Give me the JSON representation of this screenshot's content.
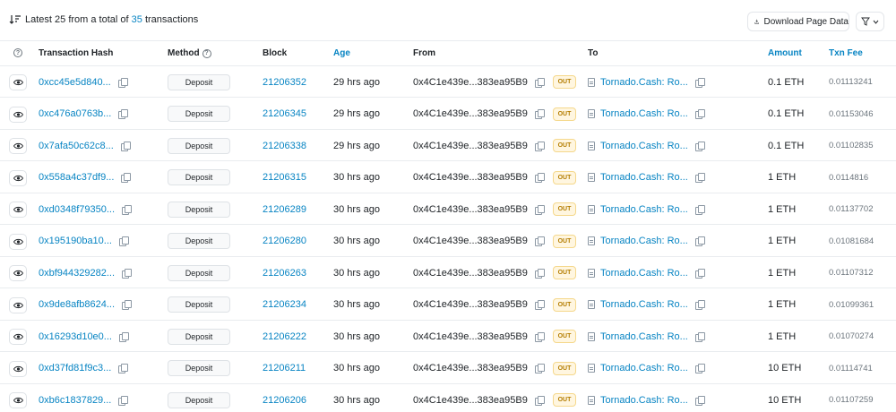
{
  "summary": {
    "prefix": "Latest 25 from a total of",
    "count": "35",
    "suffix": "transactions"
  },
  "toolbar": {
    "download_label": "Download Page Data"
  },
  "columns": {
    "info": "?",
    "hash": "Transaction Hash",
    "method": "Method",
    "block": "Block",
    "age": "Age",
    "from": "From",
    "to": "To",
    "amount": "Amount",
    "fee": "Txn Fee"
  },
  "rows": [
    {
      "hash": "0xcc45e5d840...",
      "method": "Deposit",
      "block": "21206352",
      "age": "29 hrs ago",
      "from": "0x4C1e439e...383ea95B9",
      "dir": "OUT",
      "to": "Tornado.Cash: Ro...",
      "amount": "0.1 ETH",
      "fee": "0.01113241"
    },
    {
      "hash": "0xc476a0763b...",
      "method": "Deposit",
      "block": "21206345",
      "age": "29 hrs ago",
      "from": "0x4C1e439e...383ea95B9",
      "dir": "OUT",
      "to": "Tornado.Cash: Ro...",
      "amount": "0.1 ETH",
      "fee": "0.01153046"
    },
    {
      "hash": "0x7afa50c62c8...",
      "method": "Deposit",
      "block": "21206338",
      "age": "29 hrs ago",
      "from": "0x4C1e439e...383ea95B9",
      "dir": "OUT",
      "to": "Tornado.Cash: Ro...",
      "amount": "0.1 ETH",
      "fee": "0.01102835"
    },
    {
      "hash": "0x558a4c37df9...",
      "method": "Deposit",
      "block": "21206315",
      "age": "30 hrs ago",
      "from": "0x4C1e439e...383ea95B9",
      "dir": "OUT",
      "to": "Tornado.Cash: Ro...",
      "amount": "1 ETH",
      "fee": "0.0114816"
    },
    {
      "hash": "0xd0348f79350...",
      "method": "Deposit",
      "block": "21206289",
      "age": "30 hrs ago",
      "from": "0x4C1e439e...383ea95B9",
      "dir": "OUT",
      "to": "Tornado.Cash: Ro...",
      "amount": "1 ETH",
      "fee": "0.01137702"
    },
    {
      "hash": "0x195190ba10...",
      "method": "Deposit",
      "block": "21206280",
      "age": "30 hrs ago",
      "from": "0x4C1e439e...383ea95B9",
      "dir": "OUT",
      "to": "Tornado.Cash: Ro...",
      "amount": "1 ETH",
      "fee": "0.01081684"
    },
    {
      "hash": "0xbf944329282...",
      "method": "Deposit",
      "block": "21206263",
      "age": "30 hrs ago",
      "from": "0x4C1e439e...383ea95B9",
      "dir": "OUT",
      "to": "Tornado.Cash: Ro...",
      "amount": "1 ETH",
      "fee": "0.01107312"
    },
    {
      "hash": "0x9de8afb8624...",
      "method": "Deposit",
      "block": "21206234",
      "age": "30 hrs ago",
      "from": "0x4C1e439e...383ea95B9",
      "dir": "OUT",
      "to": "Tornado.Cash: Ro...",
      "amount": "1 ETH",
      "fee": "0.01099361"
    },
    {
      "hash": "0x16293d10e0...",
      "method": "Deposit",
      "block": "21206222",
      "age": "30 hrs ago",
      "from": "0x4C1e439e...383ea95B9",
      "dir": "OUT",
      "to": "Tornado.Cash: Ro...",
      "amount": "1 ETH",
      "fee": "0.01070274"
    },
    {
      "hash": "0xd37fd81f9c3...",
      "method": "Deposit",
      "block": "21206211",
      "age": "30 hrs ago",
      "from": "0x4C1e439e...383ea95B9",
      "dir": "OUT",
      "to": "Tornado.Cash: Ro...",
      "amount": "10 ETH",
      "fee": "0.01114741"
    },
    {
      "hash": "0xb6c1837829...",
      "method": "Deposit",
      "block": "21206206",
      "age": "30 hrs ago",
      "from": "0x4C1e439e...383ea95B9",
      "dir": "OUT",
      "to": "Tornado.Cash: Ro...",
      "amount": "10 ETH",
      "fee": "0.01107259"
    }
  ]
}
